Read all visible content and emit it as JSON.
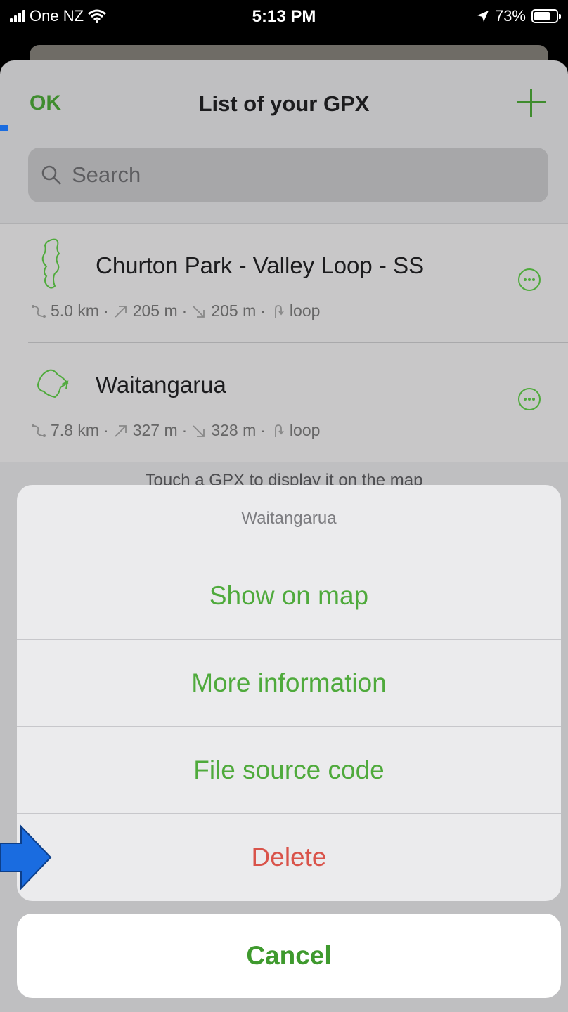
{
  "status_bar": {
    "carrier": "One NZ",
    "time": "5:13 PM",
    "battery_text": "73%",
    "battery_level": 0.73,
    "icons": [
      "signal-bars-icon",
      "wifi-icon",
      "location-arrow-icon",
      "battery-icon"
    ]
  },
  "nav": {
    "ok_label": "OK",
    "title": "List of your GPX",
    "add_icon": "plus-icon"
  },
  "search": {
    "placeholder": "Search"
  },
  "tracks": [
    {
      "name": "Churton Park - Valley Loop - SS",
      "distance": "5.0 km",
      "ascent": "205 m",
      "descent": "205 m",
      "type": "loop",
      "sep": "·"
    },
    {
      "name": "Waitangarua",
      "distance": "7.8 km",
      "ascent": "327 m",
      "descent": "328 m",
      "type": "loop",
      "sep": "·"
    }
  ],
  "hint": "Touch a GPX to display it on the map",
  "action_sheet": {
    "title": "Waitangarua",
    "show_on_map": "Show on map",
    "more_information": "More information",
    "file_source_code": "File source code",
    "delete": "Delete",
    "cancel": "Cancel"
  },
  "colors": {
    "accent_green": "#4faa3c",
    "delete_red": "#d9534a",
    "annotation_blue": "#1a6ce0"
  }
}
